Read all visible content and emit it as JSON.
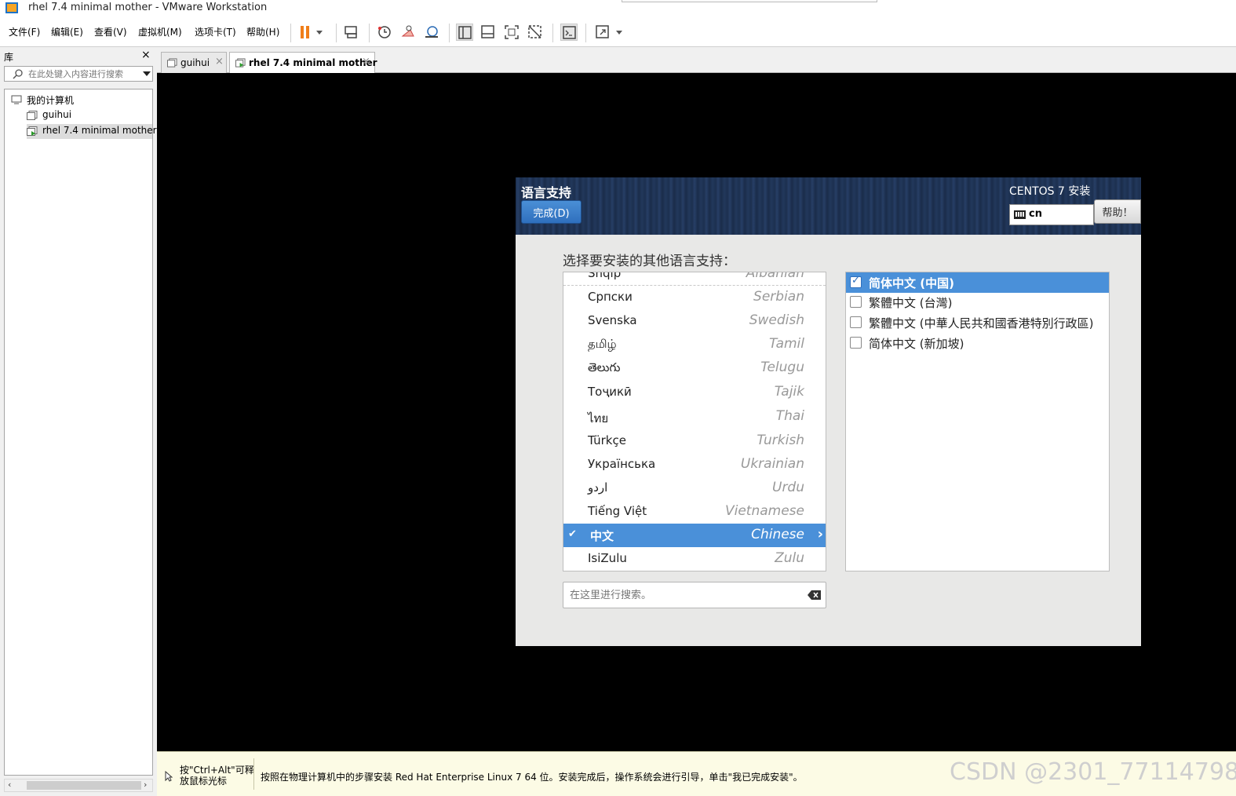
{
  "window": {
    "title": "rhel 7.4 minimal mother - VMware Workstation"
  },
  "menu": {
    "items": [
      "文件(F)",
      "编辑(E)",
      "查看(V)",
      "虚拟机(M)",
      "选项卡(T)",
      "帮助(H)"
    ]
  },
  "toolbar": {
    "icons": [
      "pause-icon",
      "dropdown-arrow-icon",
      "send-keys-icon",
      "snapshot-icon",
      "revert-snapshot-icon",
      "snapshot-manager-icon",
      "show-library-icon",
      "thumbnail-bar-icon",
      "fullscreen-icon",
      "unity-icon",
      "console-icon",
      "stretch-icon"
    ],
    "accent": "#f07e1a"
  },
  "library": {
    "title": "库",
    "close": "×",
    "search_placeholder": "在此处键入内容进行搜索",
    "tree": {
      "root": "我的计算机",
      "vms": [
        "guihui",
        "rhel 7.4 minimal mother"
      ]
    }
  },
  "tabs": [
    {
      "label": "guihui",
      "active": false
    },
    {
      "label": "rhel 7.4 minimal mother",
      "active": true
    }
  ],
  "installer": {
    "title": "语言支持",
    "done_button": "完成(D)",
    "product": "CENTOS 7 安装",
    "keyboard_layout": "cn",
    "help_button": "帮助！",
    "prompt": "选择要安装的其他语言支持：",
    "languages": [
      {
        "native": "Shqip",
        "english": "Albanian",
        "selected": false
      },
      {
        "native": "Српски",
        "english": "Serbian",
        "selected": false
      },
      {
        "native": "Svenska",
        "english": "Swedish",
        "selected": false
      },
      {
        "native": "தமிழ்",
        "english": "Tamil",
        "selected": false
      },
      {
        "native": "తెలుగు",
        "english": "Telugu",
        "selected": false
      },
      {
        "native": "Тоҷикӣ",
        "english": "Tajik",
        "selected": false
      },
      {
        "native": "ไทย",
        "english": "Thai",
        "selected": false
      },
      {
        "native": "Türkçe",
        "english": "Turkish",
        "selected": false
      },
      {
        "native": "Українська",
        "english": "Ukrainian",
        "selected": false
      },
      {
        "native": "اردو",
        "english": "Urdu",
        "selected": false
      },
      {
        "native": "Tiếng Việt",
        "english": "Vietnamese",
        "selected": false
      },
      {
        "native": "中文",
        "english": "Chinese",
        "selected": true
      },
      {
        "native": "IsiZulu",
        "english": "Zulu",
        "selected": false
      }
    ],
    "search_placeholder": "在这里进行搜索。",
    "locales": [
      {
        "label": "简体中文 (中国)",
        "checked": true
      },
      {
        "label": "繁體中文 (台灣)",
        "checked": false
      },
      {
        "label": "繁體中文 (中華人民共和國香港特別行政區)",
        "checked": false
      },
      {
        "label": "简体中文 (新加坡)",
        "checked": false
      }
    ],
    "accent": "#4a90d9"
  },
  "statusbar": {
    "hint": "按\"Ctrl+Alt\"可释放鼠标光标",
    "message": "按照在物理计算机中的步骤安装 Red Hat Enterprise Linux 7 64 位。安装完成后，操作系统会进行引导，单击\"我已完成安装\"。",
    "watermark": "CSDN @2301_77114798"
  }
}
